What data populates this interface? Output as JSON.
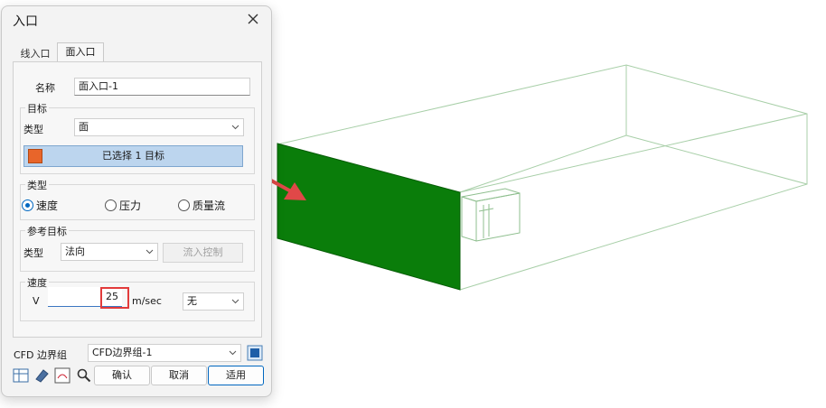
{
  "dialog": {
    "title": "入口",
    "tabs": [
      {
        "label": "线入口",
        "active": false
      },
      {
        "label": "面入口",
        "active": true
      }
    ],
    "name": {
      "label": "名称",
      "value": "面入口-1"
    },
    "target": {
      "group_title": "目标",
      "type_label": "类型",
      "type_value": "面",
      "select_button": "已选择 1 目标"
    },
    "flow_type": {
      "group_title": "类型",
      "options": [
        {
          "label": "速度",
          "checked": true
        },
        {
          "label": "压力",
          "checked": false
        },
        {
          "label": "质量流",
          "checked": false
        }
      ]
    },
    "reference": {
      "group_title": "参考目标",
      "type_label": "类型",
      "type_value": "法向",
      "inflow_button": "流入控制"
    },
    "velocity": {
      "group_title": "速度",
      "label": "V",
      "value": "25",
      "unit": "m/sec",
      "mode": "无"
    },
    "boundary_group": {
      "label": "CFD 边界组",
      "value": "CFD边界组-1"
    },
    "buttons": {
      "ok": "确认",
      "cancel": "取消",
      "apply": "适用"
    },
    "tool_icons": [
      "table-icon",
      "eraser-icon",
      "cfd-settings-icon",
      "magnifier-icon"
    ]
  },
  "colors": {
    "inlet_face": "#0a7d0a",
    "wireframe": "#a8cfa8",
    "arrow": "#e04848",
    "highlight": "#e23b3b",
    "accent": "#0067c0"
  }
}
